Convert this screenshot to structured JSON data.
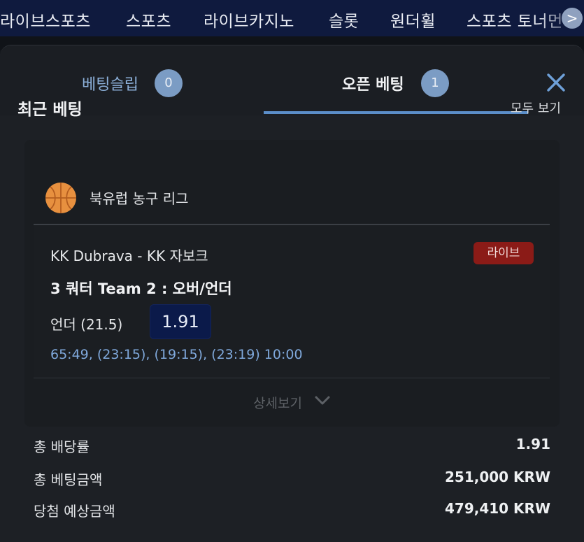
{
  "nav": {
    "items": [
      "라이브스포츠",
      "스포츠",
      "라이브카지노",
      "슬롯",
      "원더휠",
      "스포츠 토너먼"
    ],
    "next_arrow": ">"
  },
  "tabs": {
    "betslip_label": "베팅슬립",
    "betslip_count": "0",
    "open_label": "오픈 베팅",
    "open_count": "1",
    "close_icon": "close-icon"
  },
  "recent": {
    "title": "최근 베팅",
    "view_all": "모두 보기"
  },
  "bet": {
    "league": "북유럽 농구 리그",
    "league_icon": "basketball-icon",
    "match": "KK Dubrava - KK 자보크",
    "live_label": "라이브",
    "market": "3 쿼터 Team 2 : 오버/언더",
    "selection": "언더 (21.5)",
    "odds": "1.91",
    "score": "65:49, (23:15), (19:15), (23:19) 10:00",
    "details_label": "상세보기"
  },
  "summary": {
    "total_odds_label": "총 배당률",
    "total_odds_value": "1.91",
    "total_stake_label": "총 베팅금액",
    "total_stake_value": "251,000 KRW",
    "potential_win_label": "당첨 예상금액",
    "potential_win_value": "479,410 KRW"
  },
  "colors": {
    "nav_bg": "#0f1a3e",
    "accent": "#5b8ec9",
    "live_badge": "#8b1b17",
    "odds_bg": "#0b1a4a",
    "score_text": "#7fa8db"
  }
}
